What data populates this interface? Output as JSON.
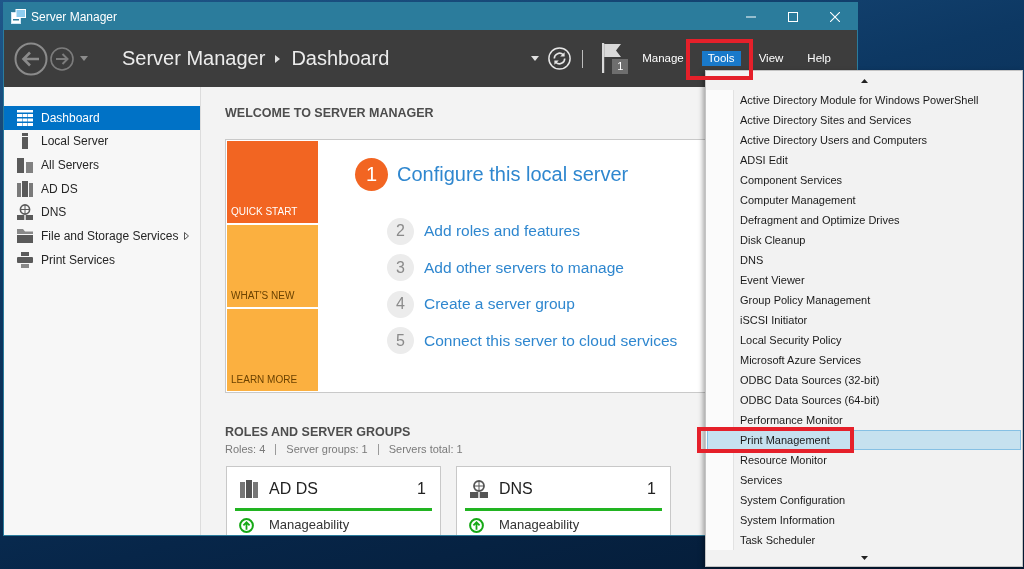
{
  "window": {
    "title": "Server Manager"
  },
  "header": {
    "breadcrumb": [
      {
        "label": "Server Manager"
      },
      {
        "label": "Dashboard"
      }
    ],
    "notification_count": "1",
    "menu": [
      {
        "label": "Manage",
        "selected": false,
        "annotated": false
      },
      {
        "label": "Tools",
        "selected": true,
        "annotated": true
      },
      {
        "label": "View",
        "selected": false,
        "annotated": false
      },
      {
        "label": "Help",
        "selected": false,
        "annotated": false
      }
    ]
  },
  "sidebar": {
    "items": [
      {
        "label": "Dashboard",
        "selected": true,
        "expandable": false
      },
      {
        "label": "Local Server",
        "selected": false,
        "expandable": false
      },
      {
        "label": "All Servers",
        "selected": false,
        "expandable": false
      },
      {
        "label": "AD DS",
        "selected": false,
        "expandable": false
      },
      {
        "label": "DNS",
        "selected": false,
        "expandable": false
      },
      {
        "label": "File and Storage Services",
        "selected": false,
        "expandable": true
      },
      {
        "label": "Print Services",
        "selected": false,
        "expandable": false
      }
    ]
  },
  "welcome": {
    "title": "WELCOME TO SERVER MANAGER",
    "tiles": [
      {
        "label": "QUICK START",
        "selected": true
      },
      {
        "label": "WHAT'S NEW",
        "selected": false
      },
      {
        "label": "LEARN MORE",
        "selected": false
      }
    ],
    "steps": [
      {
        "number": "1",
        "label": "Configure this local server",
        "kind": "primary"
      },
      {
        "number": "2",
        "label": "Add roles and features",
        "kind": "secondary"
      },
      {
        "number": "3",
        "label": "Add other servers to manage",
        "kind": "secondary"
      },
      {
        "number": "4",
        "label": "Create a server group",
        "kind": "secondary"
      },
      {
        "number": "5",
        "label": "Connect this server to cloud services",
        "kind": "secondary"
      }
    ]
  },
  "roles": {
    "title": "ROLES AND SERVER GROUPS",
    "stats": [
      "Roles: 4",
      "Server groups: 1",
      "Servers total: 1"
    ],
    "cards": [
      {
        "name": "AD DS",
        "count": "1",
        "status_label": "Manageability"
      },
      {
        "name": "DNS",
        "count": "1",
        "status_label": "Manageability"
      }
    ]
  },
  "tools_menu": {
    "items": [
      {
        "label": "Active Directory Module for Windows PowerShell",
        "selected": false,
        "annotated": false
      },
      {
        "label": "Active Directory Sites and Services",
        "selected": false,
        "annotated": false
      },
      {
        "label": "Active Directory Users and Computers",
        "selected": false,
        "annotated": false
      },
      {
        "label": "ADSI Edit",
        "selected": false,
        "annotated": false
      },
      {
        "label": "Component Services",
        "selected": false,
        "annotated": false
      },
      {
        "label": "Computer Management",
        "selected": false,
        "annotated": false
      },
      {
        "label": "Defragment and Optimize Drives",
        "selected": false,
        "annotated": false
      },
      {
        "label": "Disk Cleanup",
        "selected": false,
        "annotated": false
      },
      {
        "label": "DNS",
        "selected": false,
        "annotated": false
      },
      {
        "label": "Event Viewer",
        "selected": false,
        "annotated": false
      },
      {
        "label": "Group Policy Management",
        "selected": false,
        "annotated": false
      },
      {
        "label": "iSCSI Initiator",
        "selected": false,
        "annotated": false
      },
      {
        "label": "Local Security Policy",
        "selected": false,
        "annotated": false
      },
      {
        "label": "Microsoft Azure Services",
        "selected": false,
        "annotated": false
      },
      {
        "label": "ODBC Data Sources (32-bit)",
        "selected": false,
        "annotated": false
      },
      {
        "label": "ODBC Data Sources (64-bit)",
        "selected": false,
        "annotated": false
      },
      {
        "label": "Performance Monitor",
        "selected": false,
        "annotated": false
      },
      {
        "label": "Print Management",
        "selected": true,
        "annotated": true
      },
      {
        "label": "Resource Monitor",
        "selected": false,
        "annotated": false
      },
      {
        "label": "Services",
        "selected": false,
        "annotated": false
      },
      {
        "label": "System Configuration",
        "selected": false,
        "annotated": false
      },
      {
        "label": "System Information",
        "selected": false,
        "annotated": false
      },
      {
        "label": "Task Scheduler",
        "selected": false,
        "annotated": false
      }
    ]
  }
}
